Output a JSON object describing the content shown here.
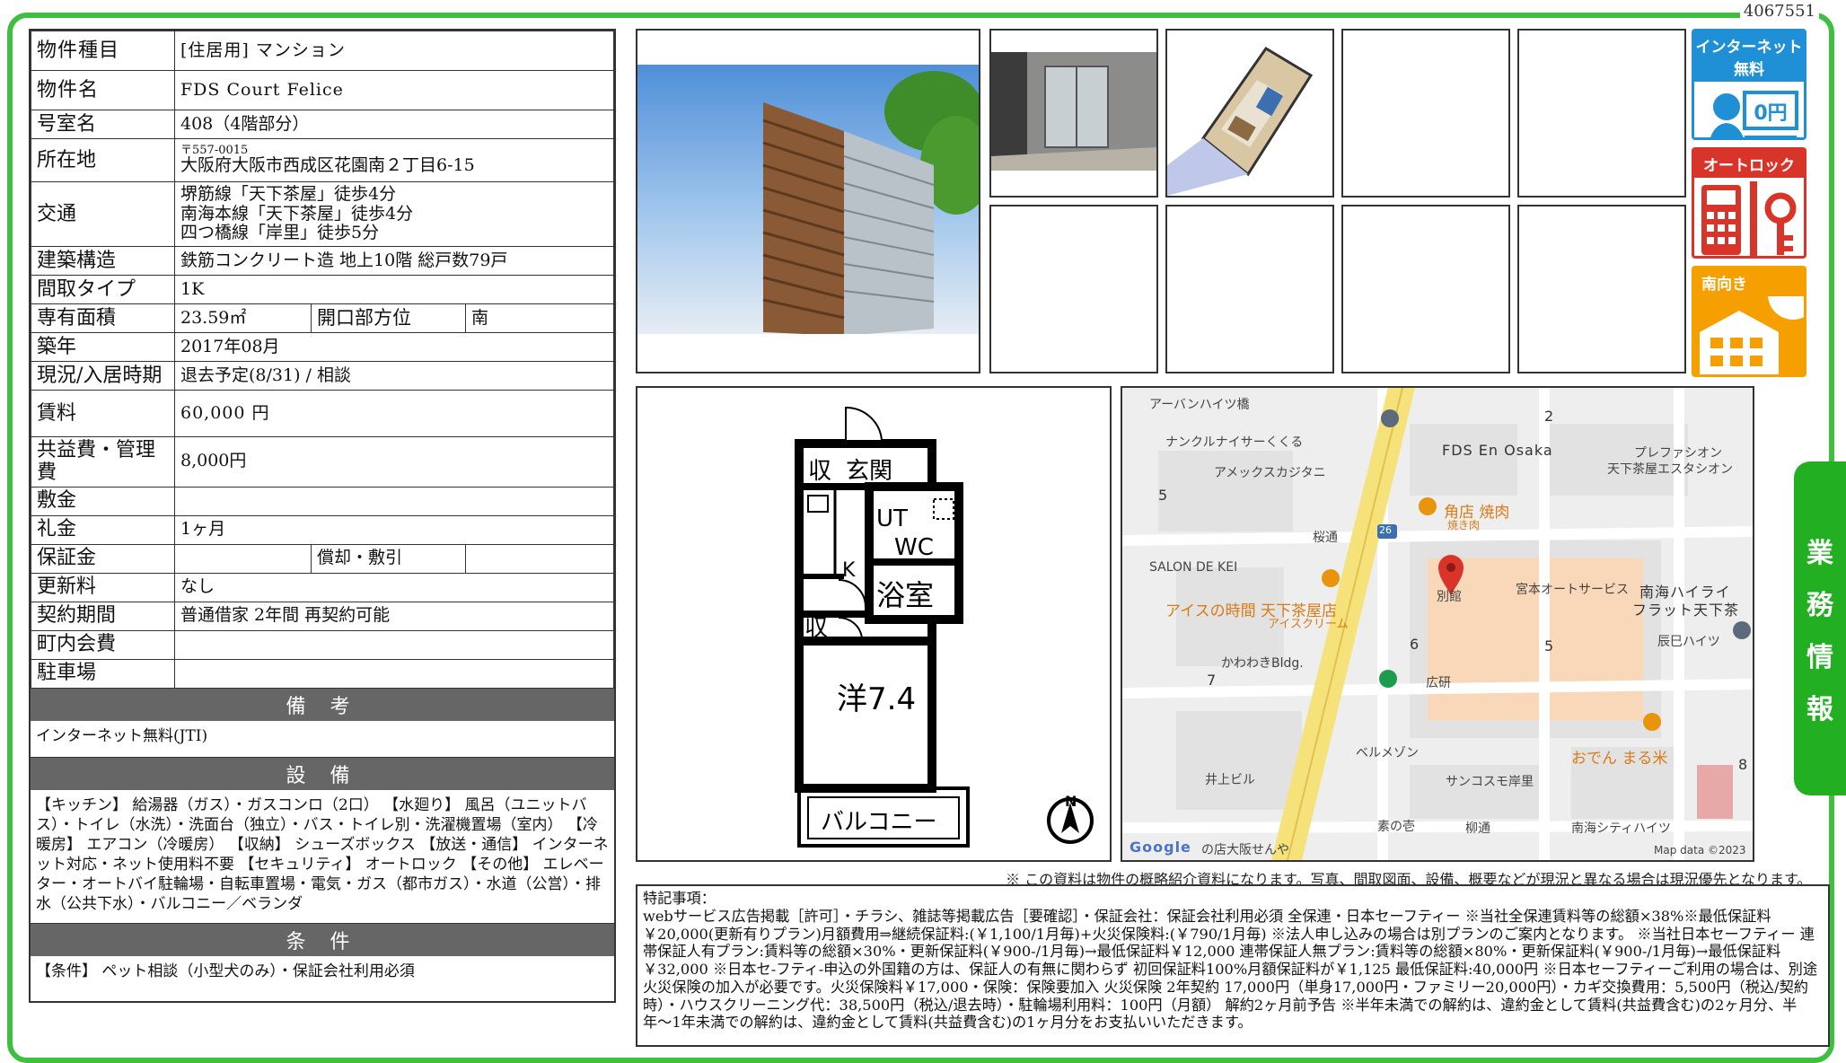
{
  "doc_number": "4067551",
  "property": {
    "type_label": "物件種目",
    "type_value": "[住居用] マンション",
    "name_label": "物件名",
    "name_value": "FDS Court Felice",
    "room_label": "号室名",
    "room_value": "408（4階部分）",
    "address_label": "所在地",
    "postal": "〒557-0015",
    "address": "大阪府大阪市西成区花園南２丁目6-15",
    "transport_label": "交通",
    "transport": [
      "堺筋線「天下茶屋」徒歩4分",
      "南海本線「天下茶屋」徒歩4分",
      "四つ橋線「岸里」徒歩5分"
    ],
    "structure_label": "建築構造",
    "structure_value": "鉄筋コンクリート造 地上10階 総戸数79戸",
    "layout_label": "間取タイプ",
    "layout_value": "1K",
    "area_label": "専有面積",
    "area_value": "23.59㎡",
    "direction_label": "開口部方位",
    "direction_value": "南",
    "built_label": "築年",
    "built_value": "2017年08月",
    "status_label": "現況/入居時期",
    "status_value": "退去予定(8/31) / 相談",
    "rent_label": "賃料",
    "rent_value": "60,000 円",
    "fee_label": "共益費・管理費",
    "fee_value": "8,000円",
    "deposit_label": "敷金",
    "deposit_value": "",
    "keymoney_label": "礼金",
    "keymoney_value": "1ヶ月",
    "guarantee_label": "保証金",
    "guarantee_value": "",
    "amort_label": "償却・敷引",
    "amort_value": "",
    "renewal_label": "更新料",
    "renewal_value": "なし",
    "contract_label": "契約期間",
    "contract_value": "普通借家 2年間 再契約可能",
    "community_label": "町内会費",
    "community_value": "",
    "parking_label": "駐車場",
    "parking_value": ""
  },
  "remarks": {
    "title": "備 考",
    "text": "インターネット無料(JTI)"
  },
  "facilities": {
    "title": "設 備",
    "text": "【キッチン】 給湯器（ガス）・ガスコンロ（2口） 【水廻り】 風呂（ユニットバス）・トイレ（水洗）・洗面台（独立）・バス・トイレ別・洗濯機置場（室内） 【冷暖房】 エアコン（冷暖房） 【収納】 シューズボックス 【放送・通信】 インターネット対応・ネット使用料不要 【セキュリティ】 オートロック 【その他】 エレベーター・オートバイ駐輪場・自転車置場・電気・ガス（都市ガス）・水道（公営）・排水（公共下水）・バルコニー／ベランダ"
  },
  "conditions": {
    "title": "条 件",
    "text": "【条件】 ペット相談（小型犬のみ）・保証会社利用必須"
  },
  "badges": [
    {
      "label": "インターネット無料",
      "icon": "internet-free-icon",
      "glyph": "0円",
      "color": "#1f8fd6"
    },
    {
      "label": "オートロック",
      "icon": "autolock-icon",
      "color": "#d8342a"
    },
    {
      "label": "南向き",
      "icon": "south-facing-icon",
      "color": "#f5a000"
    }
  ],
  "floor_plan": {
    "storage1": "収",
    "entrance": "玄関",
    "ut": "UT",
    "wc": "WC",
    "kitchen": "K",
    "storage2": "収",
    "bath": "浴室",
    "western": "洋7.4",
    "balcony": "バルコニー",
    "north": "N"
  },
  "map": {
    "labels": [
      "アーバンハイツ橋",
      "ナンクルナイサーくくる",
      "FDS En Osaka",
      "プレファシオン",
      "天下茶屋エスタシオン",
      "アメックスカジタニ",
      "角店 焼肉",
      "焼き肉",
      "桜通",
      "SALON DE KEI",
      "アイスの時間 天下茶屋店",
      "アイスクリーム",
      "宮本オートサービス",
      "南海ハイライ",
      "フラット天下茶",
      "辰巳ハイツ",
      "かわわきBldg.",
      "広研",
      "おでん まる米",
      "ベルメゾン",
      "井上ビル",
      "サンコスモ岸里",
      "素の壱",
      "柳通",
      "南海シティハイツ",
      "の店大阪せんや",
      "Map data ©2023",
      "Google",
      "別館",
      "26"
    ],
    "numbers": [
      "2",
      "5",
      "6",
      "5",
      "7",
      "8"
    ]
  },
  "side_tab": [
    "業",
    "務",
    "情",
    "報"
  ],
  "disclaimer": "※ この資料は物件の概略紹介資料になります。写真、間取図面、設備、概要などが現況と異なる場合は現況優先となります。",
  "notes": {
    "title": "特記事項：",
    "text": "webサービス広告掲載［許可］・チラシ、雑誌等掲載広告［要確認］・保証会社：保証会社利用必須 全保連・日本セーフティー ※当社全保連賃料等の総額×38%※最低保証料￥20,000(更新有りプラン)月額費用⇒継続保証料:(￥1,100/1月毎)+火災保険料:(￥790/1月毎) ※法人申し込みの場合は別プランのご案内となります。 ※当社日本セーフティー 連帯保証人有プラン:賃料等の総額×30%・更新保証料(￥900-/1月毎)→最低保証料￥12,000 連帯保証人無プラン:賃料等の総額×80%・更新保証料(￥900-/1月毎)→最低保証料￥32,000 ※日本セ-フティ-申込の外国籍の方は、保証人の有無に関わらず 初回保証料100%月額保証料が￥1,125 最低保証料:40,000円 ※日本セーフティーご利用の場合は、別途火災保険の加入が必要です。火災保険料￥17,000・保険：保険要加入 火災保険 2年契約 17,000円（単身17,000円・ファミリー20,000円）・カギ交換費用：5,500円（税込/契約時）・ハウスクリーニング代：38,500円（税込/退去時）・駐輪場利用料：100円（月額） 解約2ヶ月前予告 ※半年未満での解約は、違約金として賃料(共益費含む)の2ヶ月分、半年〜1年未満での解約は、違約金として賃料(共益費含む)の1ヶ月分をお支払いいただきます。"
  }
}
